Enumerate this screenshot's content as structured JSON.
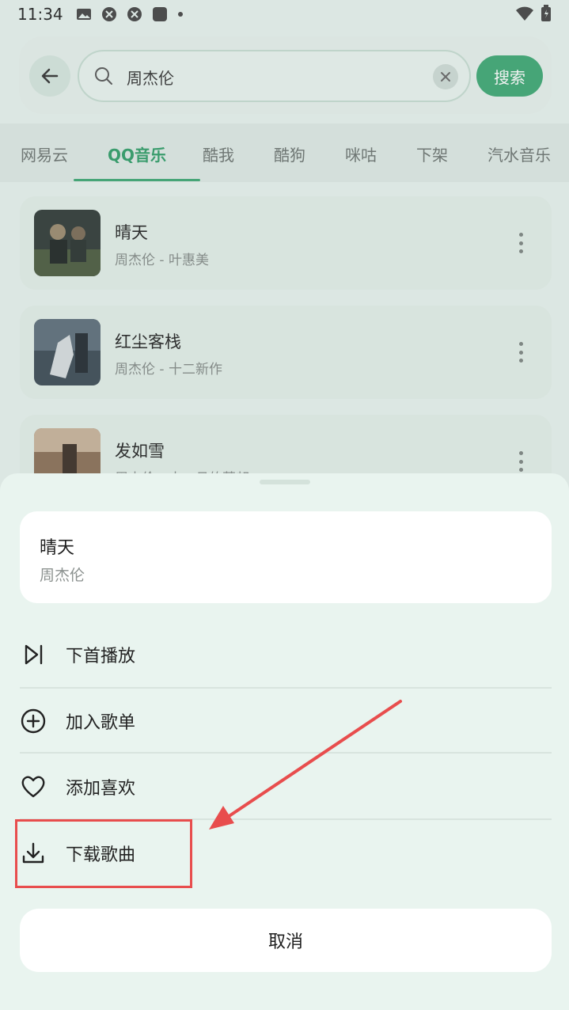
{
  "status_bar": {
    "time": "11:34"
  },
  "search": {
    "query": "周杰伦",
    "button_label": "搜索"
  },
  "tabs": [
    {
      "label": "网易云",
      "active": false
    },
    {
      "label": "QQ音乐",
      "active": true
    },
    {
      "label": "酷我",
      "active": false
    },
    {
      "label": "酷狗",
      "active": false
    },
    {
      "label": "咪咕",
      "active": false
    },
    {
      "label": "下架",
      "active": false
    },
    {
      "label": "汽水音乐",
      "active": false
    }
  ],
  "songs": [
    {
      "title": "晴天",
      "subtitle": "周杰伦 - 叶惠美"
    },
    {
      "title": "红尘客栈",
      "subtitle": "周杰伦 - 十二新作"
    },
    {
      "title": "发如雪",
      "subtitle": "周杰伦 - 十一月的萧邦"
    }
  ],
  "sheet": {
    "song_title": "晴天",
    "song_artist": "周杰伦",
    "menu": [
      {
        "label": "下首播放",
        "icon": "play-next-icon"
      },
      {
        "label": "加入歌单",
        "icon": "add-circle-icon"
      },
      {
        "label": "添加喜欢",
        "icon": "heart-icon"
      },
      {
        "label": "下载歌曲",
        "icon": "download-icon"
      }
    ],
    "cancel_label": "取消"
  },
  "colors": {
    "accent": "#3da873",
    "annotation": "#e84d4d"
  }
}
